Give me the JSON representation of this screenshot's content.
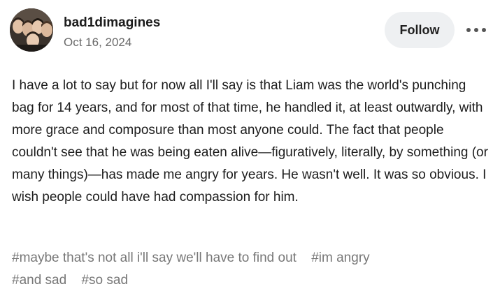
{
  "post": {
    "blog_name": "bad1dimagines",
    "date": "Oct 16, 2024",
    "avatar_icon": "group-photo-avatar",
    "follow_label": "Follow",
    "more_icon": "ellipsis-icon",
    "body": "I have a lot to say but for now all I'll say is that Liam was the world's punching bag for 14 years, and for most of that time, he handled it, at least outwardly, with more grace and composure than most anyone could. The fact that people couldn't see that he was being eaten alive—figuratively, literally, by something (or many things)—has made me angry for years. He wasn't well. It was so obvious. I wish people could have had compassion for him.",
    "tags": [
      "#maybe that's not all i'll say we'll have to find out",
      "#im angry",
      "#and sad",
      "#so sad"
    ]
  },
  "colors": {
    "follow_bg": "#eef0f2",
    "tag_text": "#777777",
    "date_text": "#6a6a6a"
  }
}
